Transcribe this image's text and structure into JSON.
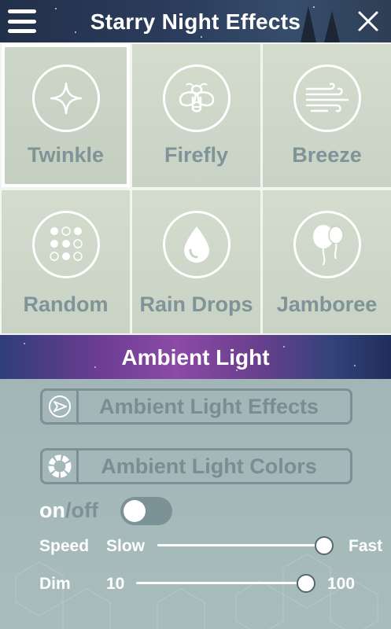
{
  "header": {
    "title": "Starry Night Effects",
    "menu_icon": "hamburger-menu-icon",
    "close_icon": "close-icon"
  },
  "effects": [
    {
      "label": "Twinkle",
      "icon": "sparkle-icon",
      "selected": true
    },
    {
      "label": "Firefly",
      "icon": "firefly-icon",
      "selected": false
    },
    {
      "label": "Breeze",
      "icon": "wind-icon",
      "selected": false
    },
    {
      "label": "Random",
      "icon": "dots-icon",
      "selected": false
    },
    {
      "label": "Rain Drops",
      "icon": "water-drop-icon",
      "selected": false
    },
    {
      "label": "Jamboree",
      "icon": "balloons-icon",
      "selected": false
    }
  ],
  "ambient": {
    "title": "Ambient Light",
    "effects_button": "Ambient Light Effects",
    "colors_button": "Ambient Light Colors",
    "onoff": {
      "on": "on",
      "slash": "/",
      "off": "off",
      "state": false
    },
    "speed": {
      "label": "Speed",
      "min_label": "Slow",
      "max_label": "Fast",
      "value": 0.97
    },
    "dim": {
      "label": "Dim",
      "min_label": "10",
      "max_label": "100",
      "value": 0.98
    }
  },
  "colors": {
    "label_gray": "#7f9398",
    "header_bg": "#2b3c5c",
    "toggle_off": "#7b9297"
  }
}
